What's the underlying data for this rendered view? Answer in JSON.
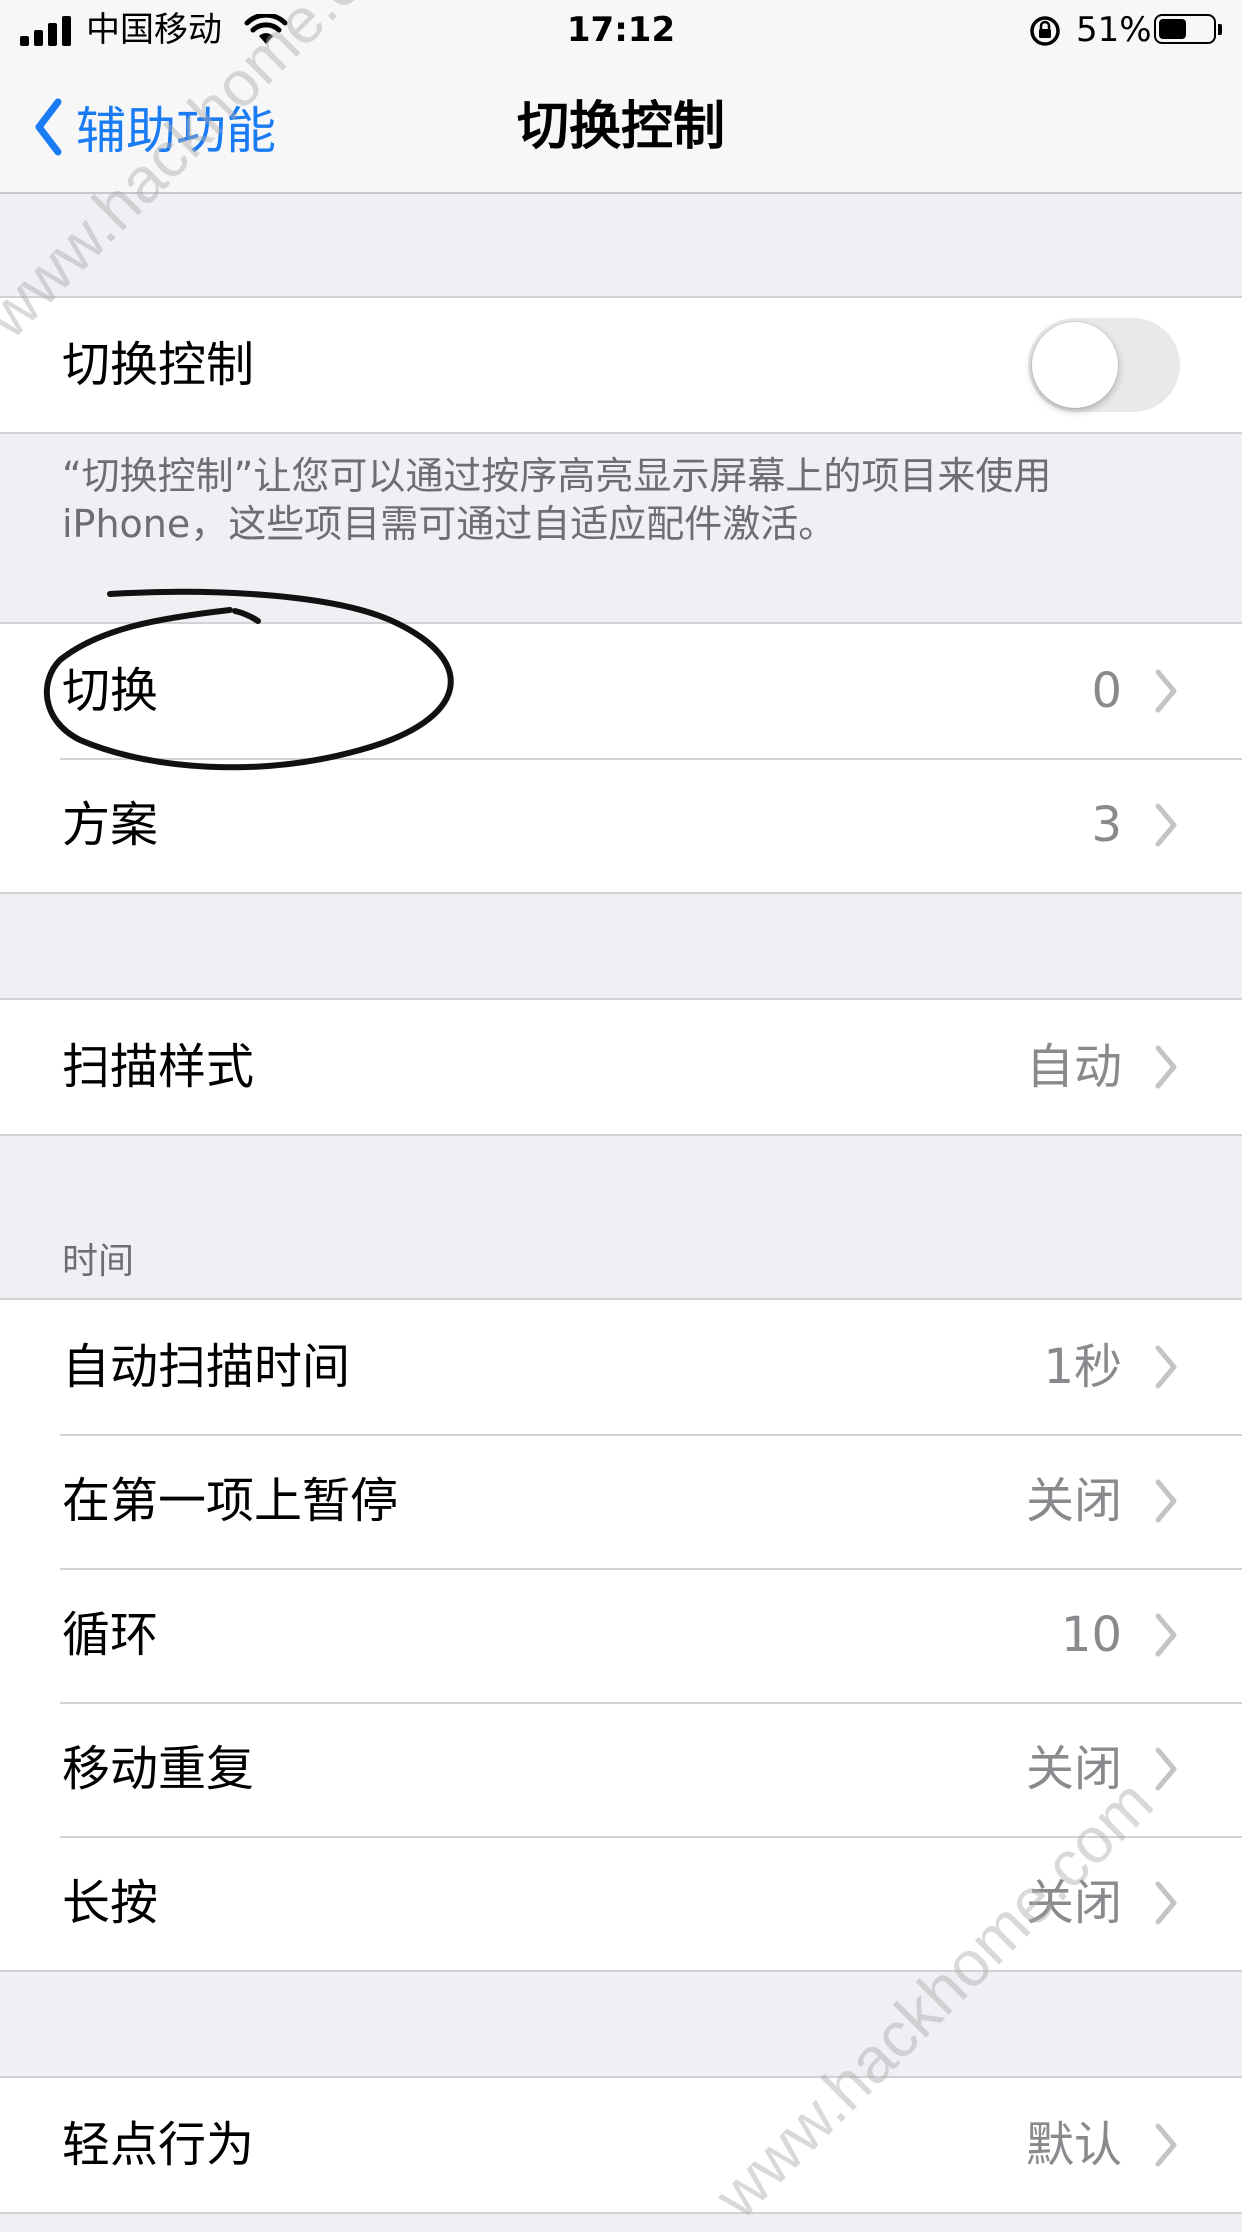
{
  "status_bar": {
    "carrier": "中国移动",
    "time": "17:12",
    "battery_percent": "51%",
    "battery_level": 0.51,
    "icons": [
      "signal-bars-icon",
      "wifi-icon",
      "orientation-lock-icon",
      "battery-icon"
    ]
  },
  "nav": {
    "back_label": "辅助功能",
    "title": "切换控制"
  },
  "switch_control": {
    "label": "切换控制",
    "toggle_on": false,
    "footer": "“切换控制”让您可以通过按序高亮显示屏幕上的项目来使用iPhone，这些项目需可通过自适应配件激活。"
  },
  "group_switches": [
    {
      "label": "切换",
      "value": "0"
    },
    {
      "label": "方案",
      "value": "3"
    }
  ],
  "group_scan": [
    {
      "label": "扫描样式",
      "value": "自动"
    }
  ],
  "timing": {
    "header": "时间",
    "rows": [
      {
        "label": "自动扫描时间",
        "value": "1秒"
      },
      {
        "label": "在第一项上暂停",
        "value": "关闭"
      },
      {
        "label": "循环",
        "value": "10"
      },
      {
        "label": "移动重复",
        "value": "关闭"
      },
      {
        "label": "长按",
        "value": "关闭"
      }
    ]
  },
  "group_tap": [
    {
      "label": "轻点行为",
      "value": "默认"
    }
  ],
  "watermark": "www.hackhome.com",
  "colors": {
    "accent": "#1a7cf5",
    "background": "#efeff4",
    "secondary_text": "#8a8a8e",
    "annotation": "#111111"
  }
}
